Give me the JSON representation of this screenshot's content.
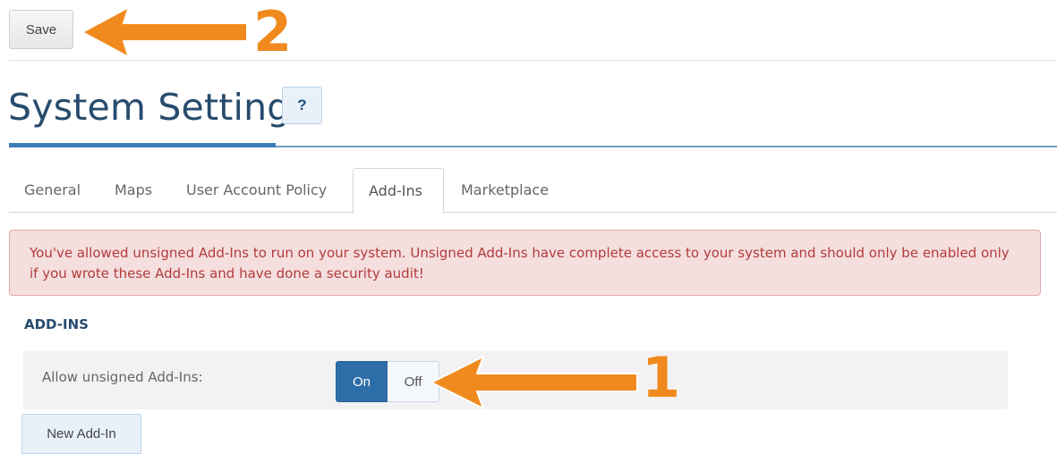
{
  "toolbar": {
    "save_label": "Save"
  },
  "header": {
    "title": "System Settings",
    "help_label": "?"
  },
  "tabs": [
    {
      "label": "General",
      "active": false
    },
    {
      "label": "Maps",
      "active": false
    },
    {
      "label": "User Account Policy",
      "active": false
    },
    {
      "label": "Add-Ins",
      "active": true
    },
    {
      "label": "Marketplace",
      "active": false
    }
  ],
  "alert": {
    "text": "You've allowed unsigned Add-Ins to run on your system. Unsigned Add-Ins have complete access to your system and should only be enabled only if you wrote these Add-Ins and have done a security audit!"
  },
  "section": {
    "heading": "ADD-INS",
    "setting_label": "Allow unsigned Add-Ins:",
    "toggle_on": "On",
    "toggle_off": "Off",
    "selected": "On"
  },
  "new_addin_label": "New Add-In",
  "annotations": {
    "label_1": "1",
    "label_2": "2",
    "color": "#f08a1e"
  },
  "colors": {
    "title": "#274b6d",
    "accent": "#2e6ea8",
    "alert_bg": "#f5dede",
    "alert_text": "#b23c3c"
  }
}
